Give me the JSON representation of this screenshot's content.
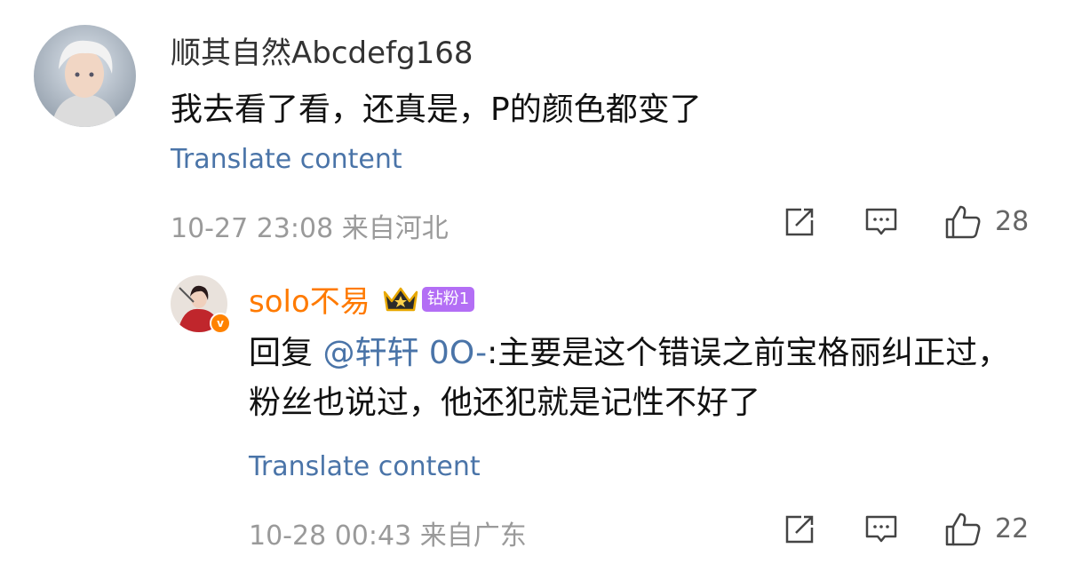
{
  "comments": [
    {
      "username": "顺其自然Abcdefg168",
      "text": "我去看了看，还真是，P的颜色都变了",
      "translate_label": "Translate content",
      "timestamp": "10-27 23:08",
      "location": "来自河北",
      "likes": "28"
    },
    {
      "username": "solo不易",
      "badge": "钻粉1",
      "reply_prefix": "回复",
      "mention": "@轩轩 0O-",
      "text": ":主要是这个错误之前宝格丽纠正过，粉丝也说过，他还犯就是记性不好了",
      "translate_label": "Translate content",
      "timestamp": "10-28 00:43",
      "location": "来自广东",
      "likes": "22"
    }
  ],
  "icons": [
    "share-icon",
    "comment-icon",
    "like-icon",
    "crown-icon",
    "verified-icon"
  ],
  "colors": {
    "username_vip": "#ff7a00",
    "link": "#4a74a8",
    "meta": "#9a9a9a",
    "badge": "#b36ef5"
  }
}
